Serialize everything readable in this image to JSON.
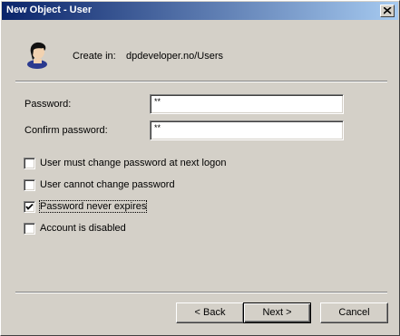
{
  "window": {
    "title": "New Object - User"
  },
  "header": {
    "create_in_label": "Create in:",
    "create_in_path": "dpdeveloper.no/Users"
  },
  "form": {
    "password_label": "Password:",
    "password_value": "**",
    "confirm_label": "Confirm password:",
    "confirm_value": "**"
  },
  "options": [
    {
      "label": "User must change password at next logon",
      "checked": false
    },
    {
      "label": "User cannot change password",
      "checked": false
    },
    {
      "label": "Password never expires",
      "checked": true
    },
    {
      "label": "Account is disabled",
      "checked": false
    }
  ],
  "buttons": {
    "back": "< Back",
    "next": "Next >",
    "cancel": "Cancel"
  },
  "colors": {
    "titlebar_start": "#0a246a",
    "titlebar_end": "#a6caf0",
    "face": "#d4d0c8"
  }
}
